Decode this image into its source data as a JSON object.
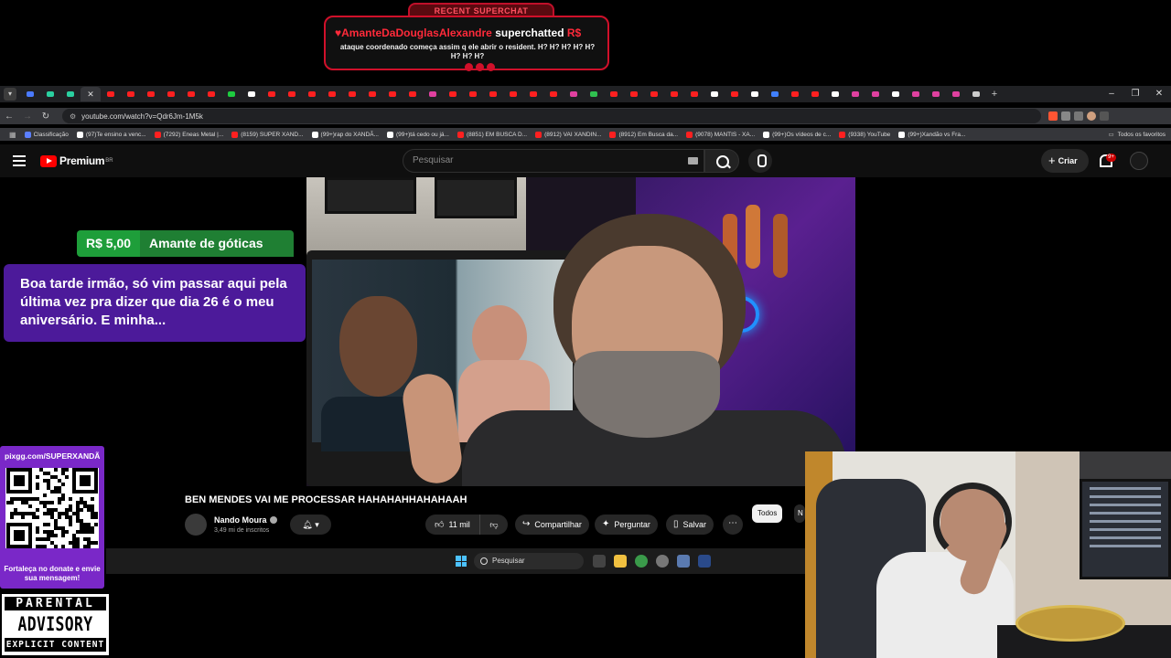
{
  "superchat_banner": {
    "tag": "RECENT SUPERCHAT",
    "user": "♥AmanteDaDouglasAlexandre",
    "action": "superchatted",
    "amount_partial": "R$",
    "message": "ataque coordenado começa assim q ele abrir o resident. H? H? H? H? H? H? H? H?"
  },
  "browser": {
    "url": "youtube.com/watch?v=Qdr6Jm-1M5k",
    "active_tab_close": "✕",
    "new_tab": "+",
    "bookmarks": [
      {
        "label": "Classificação",
        "color": "#5b7fff"
      },
      {
        "label": "(97)Te ensino a venc...",
        "color": "#ffffff"
      },
      {
        "label": "(7292) Eneas Metal |...",
        "color": "#ff2020"
      },
      {
        "label": "(8159) SUPER XAND...",
        "color": "#ff2020"
      },
      {
        "label": "(99+)rap do XANDÃ...",
        "color": "#ffffff"
      },
      {
        "label": "(99+)tá cedo ou já...",
        "color": "#ffffff"
      },
      {
        "label": "(8851) EM BUSCA D...",
        "color": "#ff2020"
      },
      {
        "label": "(8912) VAI XANDIN...",
        "color": "#ff2020"
      },
      {
        "label": "(8912) Em Busca da...",
        "color": "#ff2020"
      },
      {
        "label": "(9078) MANTIS - XA...",
        "color": "#ff2020"
      },
      {
        "label": "(99+)Os vídeos de c...",
        "color": "#ffffff"
      },
      {
        "label": "(9338) YouTube",
        "color": "#ff2020"
      },
      {
        "label": "(99+)Xandão vs Fra...",
        "color": "#ffffff"
      }
    ],
    "all_bookmarks": "Todos os favoritos"
  },
  "youtube": {
    "logo": "Premium",
    "region": "BR",
    "search_placeholder": "Pesquisar",
    "create_label": "Criar",
    "notif_count": "9+",
    "video_title": "BEN MENDES VAI ME PROCESSAR HAHAHAHHAHAHAAH",
    "channel_name": "Nando Moura",
    "subscribers": "3,49 mi de inscritos",
    "likes": "11 mil",
    "share_label": "Compartilhar",
    "ask_label": "Perguntar",
    "save_label": "Salvar",
    "chip_all": "Todos",
    "chip_next": "N"
  },
  "superchat_card": {
    "amount": "R$ 5,00",
    "name": "Amante de góticas",
    "message": "Boa tarde irmão, só vim passar aqui pela última vez pra dizer que dia 26 é o meu aniversário. E minha..."
  },
  "taskbar": {
    "search_label": "Pesquisar"
  },
  "pix_panel": {
    "url": "pixgg.com/SUPERXANDÃ",
    "note": "Fortaleça no donate e envie sua mensagem!"
  },
  "advisory": {
    "line1": "PARENTAL",
    "line2": "ADVISORY",
    "line3": "EXPLICIT CONTENT"
  }
}
